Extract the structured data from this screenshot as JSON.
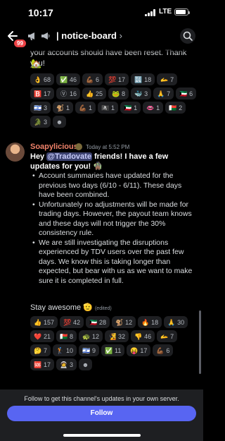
{
  "status": {
    "time": "10:17",
    "network": "LTE",
    "battery_level": 0.85
  },
  "header": {
    "unread_badge": "99",
    "channel": "| notice-board",
    "chevron": "›"
  },
  "previous_message": {
    "text_tail": "your accounts should have been reset. Thank you!",
    "emoji": "🏡",
    "reactions": [
      {
        "emoji": "👌",
        "count": "68"
      },
      {
        "emoji": "✅",
        "count": "46"
      },
      {
        "emoji": "💪🏾",
        "count": "6"
      },
      {
        "emoji": "💯",
        "count": "17"
      },
      {
        "emoji": "🔣",
        "count": "18"
      },
      {
        "emoji": "🫴",
        "count": "7"
      },
      {
        "emoji": "🅱️",
        "count": "17"
      },
      {
        "emoji": "Ⓥ",
        "count": "16"
      },
      {
        "emoji": "👍",
        "count": "25"
      },
      {
        "emoji": "🐸",
        "count": "8"
      },
      {
        "emoji": "🐳",
        "count": "3"
      },
      {
        "emoji": "🙏",
        "count": "7"
      },
      {
        "emoji": "🇰🇼",
        "count": "6"
      },
      {
        "emoji": "🇮🇱",
        "count": "3"
      },
      {
        "emoji": "🐒",
        "count": "1"
      },
      {
        "emoji": "💪🏾",
        "count": "1"
      },
      {
        "emoji": "🏴‍☠️",
        "count": "1"
      },
      {
        "emoji": "🇰🇼",
        "count": "1"
      },
      {
        "emoji": "👄",
        "count": "1"
      },
      {
        "emoji": "🇲🇬",
        "count": "2"
      },
      {
        "emoji": "🐊",
        "count": "3"
      },
      {
        "emoji": "☻",
        "count": ""
      }
    ]
  },
  "message": {
    "author": "Soapylicious",
    "timestamp": "Today at 5:52 PM",
    "headline_pre": "Hey ",
    "mention": "@Tradovate",
    "headline_post": " friends! I have a few updates for you! 🧌",
    "bullets": [
      "Account summaries have updated for the previous two days (6/10 - 6/11). These days have been combined.",
      "Unfortunately no adjustments will be made for trading days. However, the payout team knows and these days will not trigger the 30% consistency rule.",
      "We are still investigating the disruptions experienced by TDV users over the past few days. We know this is taking longer than expected, but bear with us as we want to make sure it is completed in full."
    ],
    "signoff": "Stay awesome 🫡",
    "edited_label": "(edited)",
    "reactions": [
      {
        "emoji": "👍",
        "count": "157"
      },
      {
        "emoji": "💯",
        "count": "42"
      },
      {
        "emoji": "🇰🇼",
        "count": "28"
      },
      {
        "emoji": "🐒",
        "count": "12"
      },
      {
        "emoji": "🔥",
        "count": "18"
      },
      {
        "emoji": "🙏",
        "count": "30"
      },
      {
        "emoji": "❤️",
        "count": "21"
      },
      {
        "emoji": "🇲🇬",
        "count": "8"
      },
      {
        "emoji": "🐢",
        "count": "12"
      },
      {
        "emoji": "🧏",
        "count": "32"
      },
      {
        "emoji": "👎",
        "count": "46"
      },
      {
        "emoji": "🫴",
        "count": "7"
      },
      {
        "emoji": "🤔",
        "count": "7"
      },
      {
        "emoji": "🏌️",
        "count": "10"
      },
      {
        "emoji": "🇮🇱",
        "count": "9"
      },
      {
        "emoji": "✅",
        "count": "11"
      },
      {
        "emoji": "😝",
        "count": "17"
      },
      {
        "emoji": "💪🏾",
        "count": "6"
      },
      {
        "emoji": "🆘",
        "count": "17"
      },
      {
        "emoji": "🧑‍🚀",
        "count": "3"
      },
      {
        "emoji": "☻",
        "count": ""
      }
    ]
  },
  "footer": {
    "follow_text": "Follow to get this channel's updates in your own server.",
    "follow_label": "Follow"
  },
  "colors": {
    "accent": "#5865f2",
    "author": "#f0826a",
    "badge": "#ed4245"
  },
  "icons": [
    "back-arrow-icon",
    "megaphone-icon",
    "search-icon",
    "add-reaction-icon"
  ]
}
